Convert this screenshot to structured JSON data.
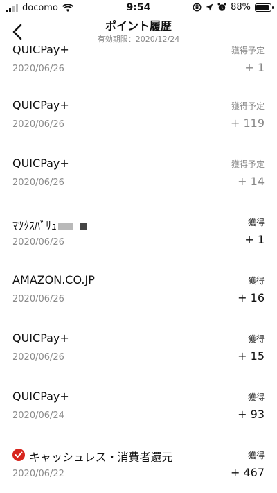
{
  "statusbar": {
    "carrier": "docomo",
    "time": "9:54",
    "battery": "88%",
    "icons": [
      "signal-icon",
      "wifi-icon",
      "orientation-lock-icon",
      "location-icon",
      "alarm-icon",
      "battery-icon"
    ]
  },
  "header": {
    "title": "ポイント履歴",
    "subtitle": "有効期限：2020/12/24",
    "back_icon": "chevron-left-icon"
  },
  "items": [
    {
      "name": "QUICPay+",
      "date": "2020/06/26",
      "status": "獲得予定",
      "points": "+ 1"
    },
    {
      "name": "QUICPay+",
      "date": "2020/06/26",
      "status": "獲得予定",
      "points": "+ 119"
    },
    {
      "name": "QUICPay+",
      "date": "2020/06/26",
      "status": "獲得予定",
      "points": "+ 14"
    },
    {
      "name": "ﾏﾂｸｽﾊﾞﾘｭ",
      "date": "2020/06/26",
      "status": "獲得",
      "points": "+ 1"
    },
    {
      "name": "AMAZON.CO.JP",
      "date": "2020/06/26",
      "status": "獲得",
      "points": "+ 16"
    },
    {
      "name": "QUICPay+",
      "date": "2020/06/26",
      "status": "獲得",
      "points": "+ 15"
    },
    {
      "name": "QUICPay+",
      "date": "2020/06/24",
      "status": "獲得",
      "points": "+ 93"
    },
    {
      "name": "キャッシュレス・消費者還元",
      "date": "2020/06/22",
      "status": "獲得",
      "points": "+ 467"
    }
  ],
  "colors": {
    "badge": "#d7261e",
    "muted": "#888888"
  }
}
